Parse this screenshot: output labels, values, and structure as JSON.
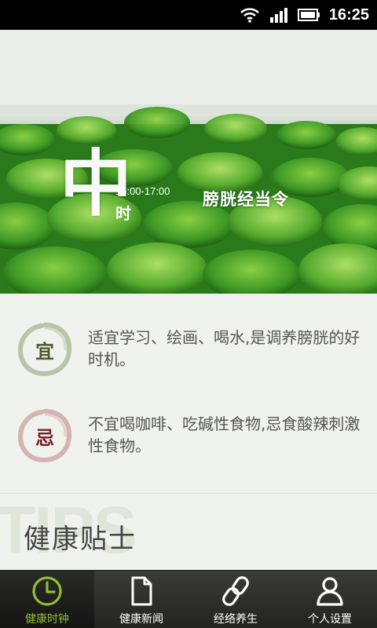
{
  "status_bar": {
    "time": "16:25",
    "icons": [
      "wifi-icon",
      "signal-icon",
      "battery-icon"
    ]
  },
  "hero": {
    "calligraphy": "中",
    "time_range": "15:00-17:00",
    "shi": "时",
    "meridian": "膀胱经当令"
  },
  "advice": {
    "yi": {
      "seal": "宜",
      "text": "适宜学习、绘画、喝水,是调养膀胱的好时机。"
    },
    "ji": {
      "seal": "忌",
      "text": "不宜喝咖啡、吃碱性食物,忌食酸辣刺激性食物。"
    }
  },
  "tips": {
    "watermark": "TIPS",
    "title": "健康贴士"
  },
  "tabbar": {
    "active_color": "#8fbf33",
    "items": [
      {
        "label": "健康时钟",
        "icon": "clock-icon",
        "active": true
      },
      {
        "label": "健康新闻",
        "icon": "document-icon",
        "active": false
      },
      {
        "label": "经络养生",
        "icon": "chain-link-icon",
        "active": false
      },
      {
        "label": "个人设置",
        "icon": "user-icon",
        "active": false
      }
    ]
  }
}
